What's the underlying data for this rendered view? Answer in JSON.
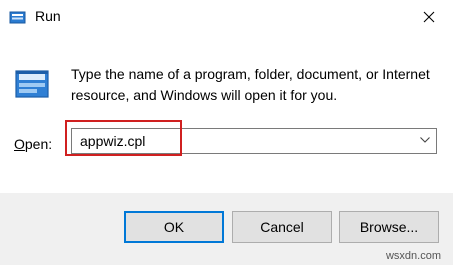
{
  "window": {
    "title": "Run",
    "icon": "run-icon",
    "close_icon": "close-icon"
  },
  "content": {
    "description": "Type the name of a program, folder, document, or Internet resource, and Windows will open it for you.",
    "open_label_accel": "O",
    "open_label_rest": "pen:",
    "input_value": "appwiz.cpl",
    "dropdown_icon": "chevron-down-icon",
    "highlight_color": "#d02020"
  },
  "buttons": {
    "ok": "OK",
    "cancel": "Cancel",
    "browse": "Browse..."
  },
  "colors": {
    "accent": "#0078d7"
  },
  "watermark": "wsxdn.com"
}
